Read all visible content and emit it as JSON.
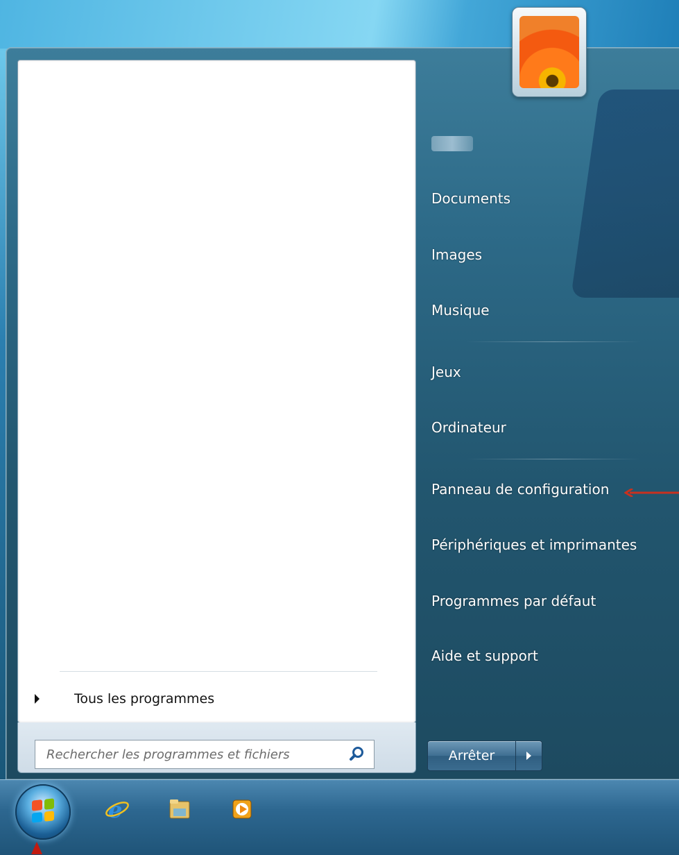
{
  "user": {
    "avatar_icon": "flower-avatar-icon"
  },
  "left_pane": {
    "all_programs_label": "Tous les programmes",
    "search_placeholder": "Rechercher les programmes et fichiers"
  },
  "right_pane": {
    "items": [
      {
        "label": "Documents"
      },
      {
        "label": "Images"
      },
      {
        "label": "Musique"
      },
      {
        "label": "Jeux"
      },
      {
        "label": "Ordinateur"
      },
      {
        "label": "Panneau de configuration"
      },
      {
        "label": "Périphériques et imprimantes"
      },
      {
        "label": "Programmes par défaut"
      },
      {
        "label": "Aide et support"
      }
    ],
    "shutdown_label": "Arrêter"
  },
  "taskbar": {
    "icons": [
      "windows-start-icon",
      "internet-explorer-icon",
      "file-explorer-icon",
      "media-player-icon"
    ]
  },
  "colors": {
    "annotation_arrow": "#c8311f",
    "menu_text": "#ffffff"
  }
}
